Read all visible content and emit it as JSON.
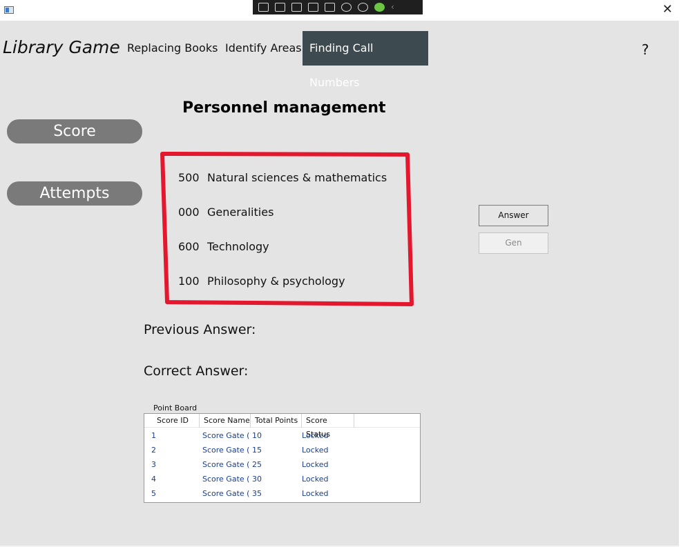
{
  "titlebar": {
    "icon": "app-window-icon",
    "close_label": "✕",
    "debug_toolbar_icons": [
      "live-visual-tree-icon",
      "record-icon",
      "select-element-icon",
      "display-layout-icon",
      "track-focus-icon",
      "hot-reload-icon",
      "accessibility-icon",
      "check-icon"
    ]
  },
  "header": {
    "app_title": "Library Game",
    "nav": [
      "Replacing Books",
      "Identify Areas",
      "Finding Call Numbers"
    ],
    "active_nav": "Finding Call Numbers",
    "help_label": "?"
  },
  "game": {
    "question": "Personnel management",
    "score_label": "Score",
    "attempts_label": "Attempts",
    "options": [
      {
        "code": "500",
        "name": "Natural sciences & mathematics"
      },
      {
        "code": "000",
        "name": "Generalities"
      },
      {
        "code": "600",
        "name": "Technology"
      },
      {
        "code": "100",
        "name": "Philosophy & psychology"
      }
    ],
    "answer_button": "Answer",
    "gen_button": "Gen",
    "previous_answer_label": "Previous Answer:",
    "correct_answer_label": "Correct Answer:"
  },
  "point_board": {
    "caption": "Point Board",
    "columns": [
      "Score ID",
      "Score Name",
      "Total Points",
      "Score Status"
    ],
    "rows": [
      [
        "1",
        "Score Gate (",
        "10",
        "Locked"
      ],
      [
        "2",
        "Score Gate (",
        "15",
        "Locked"
      ],
      [
        "3",
        "Score Gate (",
        "25",
        "Locked"
      ],
      [
        "4",
        "Score Gate (",
        "30",
        "Locked"
      ],
      [
        "5",
        "Score Gate (",
        "35",
        "Locked"
      ]
    ]
  },
  "colors": {
    "background": "#e4e4e4",
    "nav_active": "#3d4a4f",
    "pill": "#7a7a7a",
    "highlight_frame": "#e3182e",
    "row_text": "#1a3d8c"
  }
}
